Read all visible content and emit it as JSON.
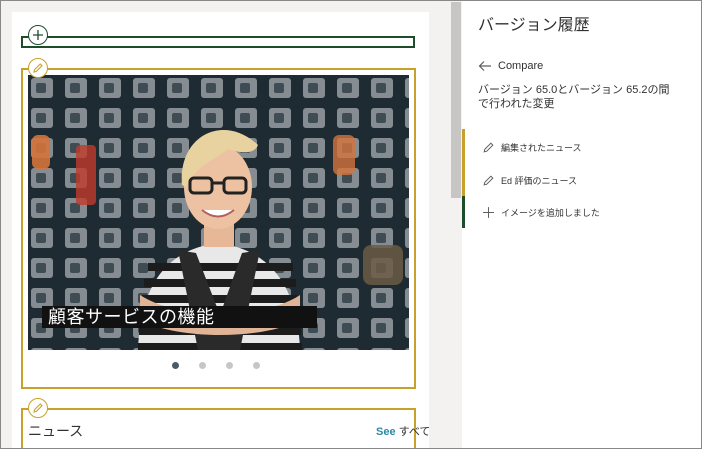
{
  "canvas": {
    "hero": {
      "caption": "顧客サービスの機能",
      "image_alt": "Smiling shop employee with arms crossed",
      "carousel": {
        "count": 4,
        "active_index": 0
      }
    },
    "news": {
      "title": "ニュース",
      "see_label": "See",
      "all_label": "すべて"
    }
  },
  "panel": {
    "title": "バージョン履歴",
    "back_label": "Compare",
    "description": "バージョン 65.0とバージョン 65.2の間で行われた変更",
    "changes": [
      {
        "label": "編集されたニュース",
        "icon": "pencil-icon",
        "color": "#c8a02c"
      },
      {
        "label": "Ed 評価のニュース",
        "icon": "pencil-icon",
        "color": "#c8a02c"
      },
      {
        "label": "イメージを追加しました",
        "icon": "plus-icon",
        "color": "#1e4d2b"
      }
    ]
  },
  "colors": {
    "edited": "#c8a02c",
    "added": "#1e4d2b",
    "link": "#2b88a8"
  }
}
